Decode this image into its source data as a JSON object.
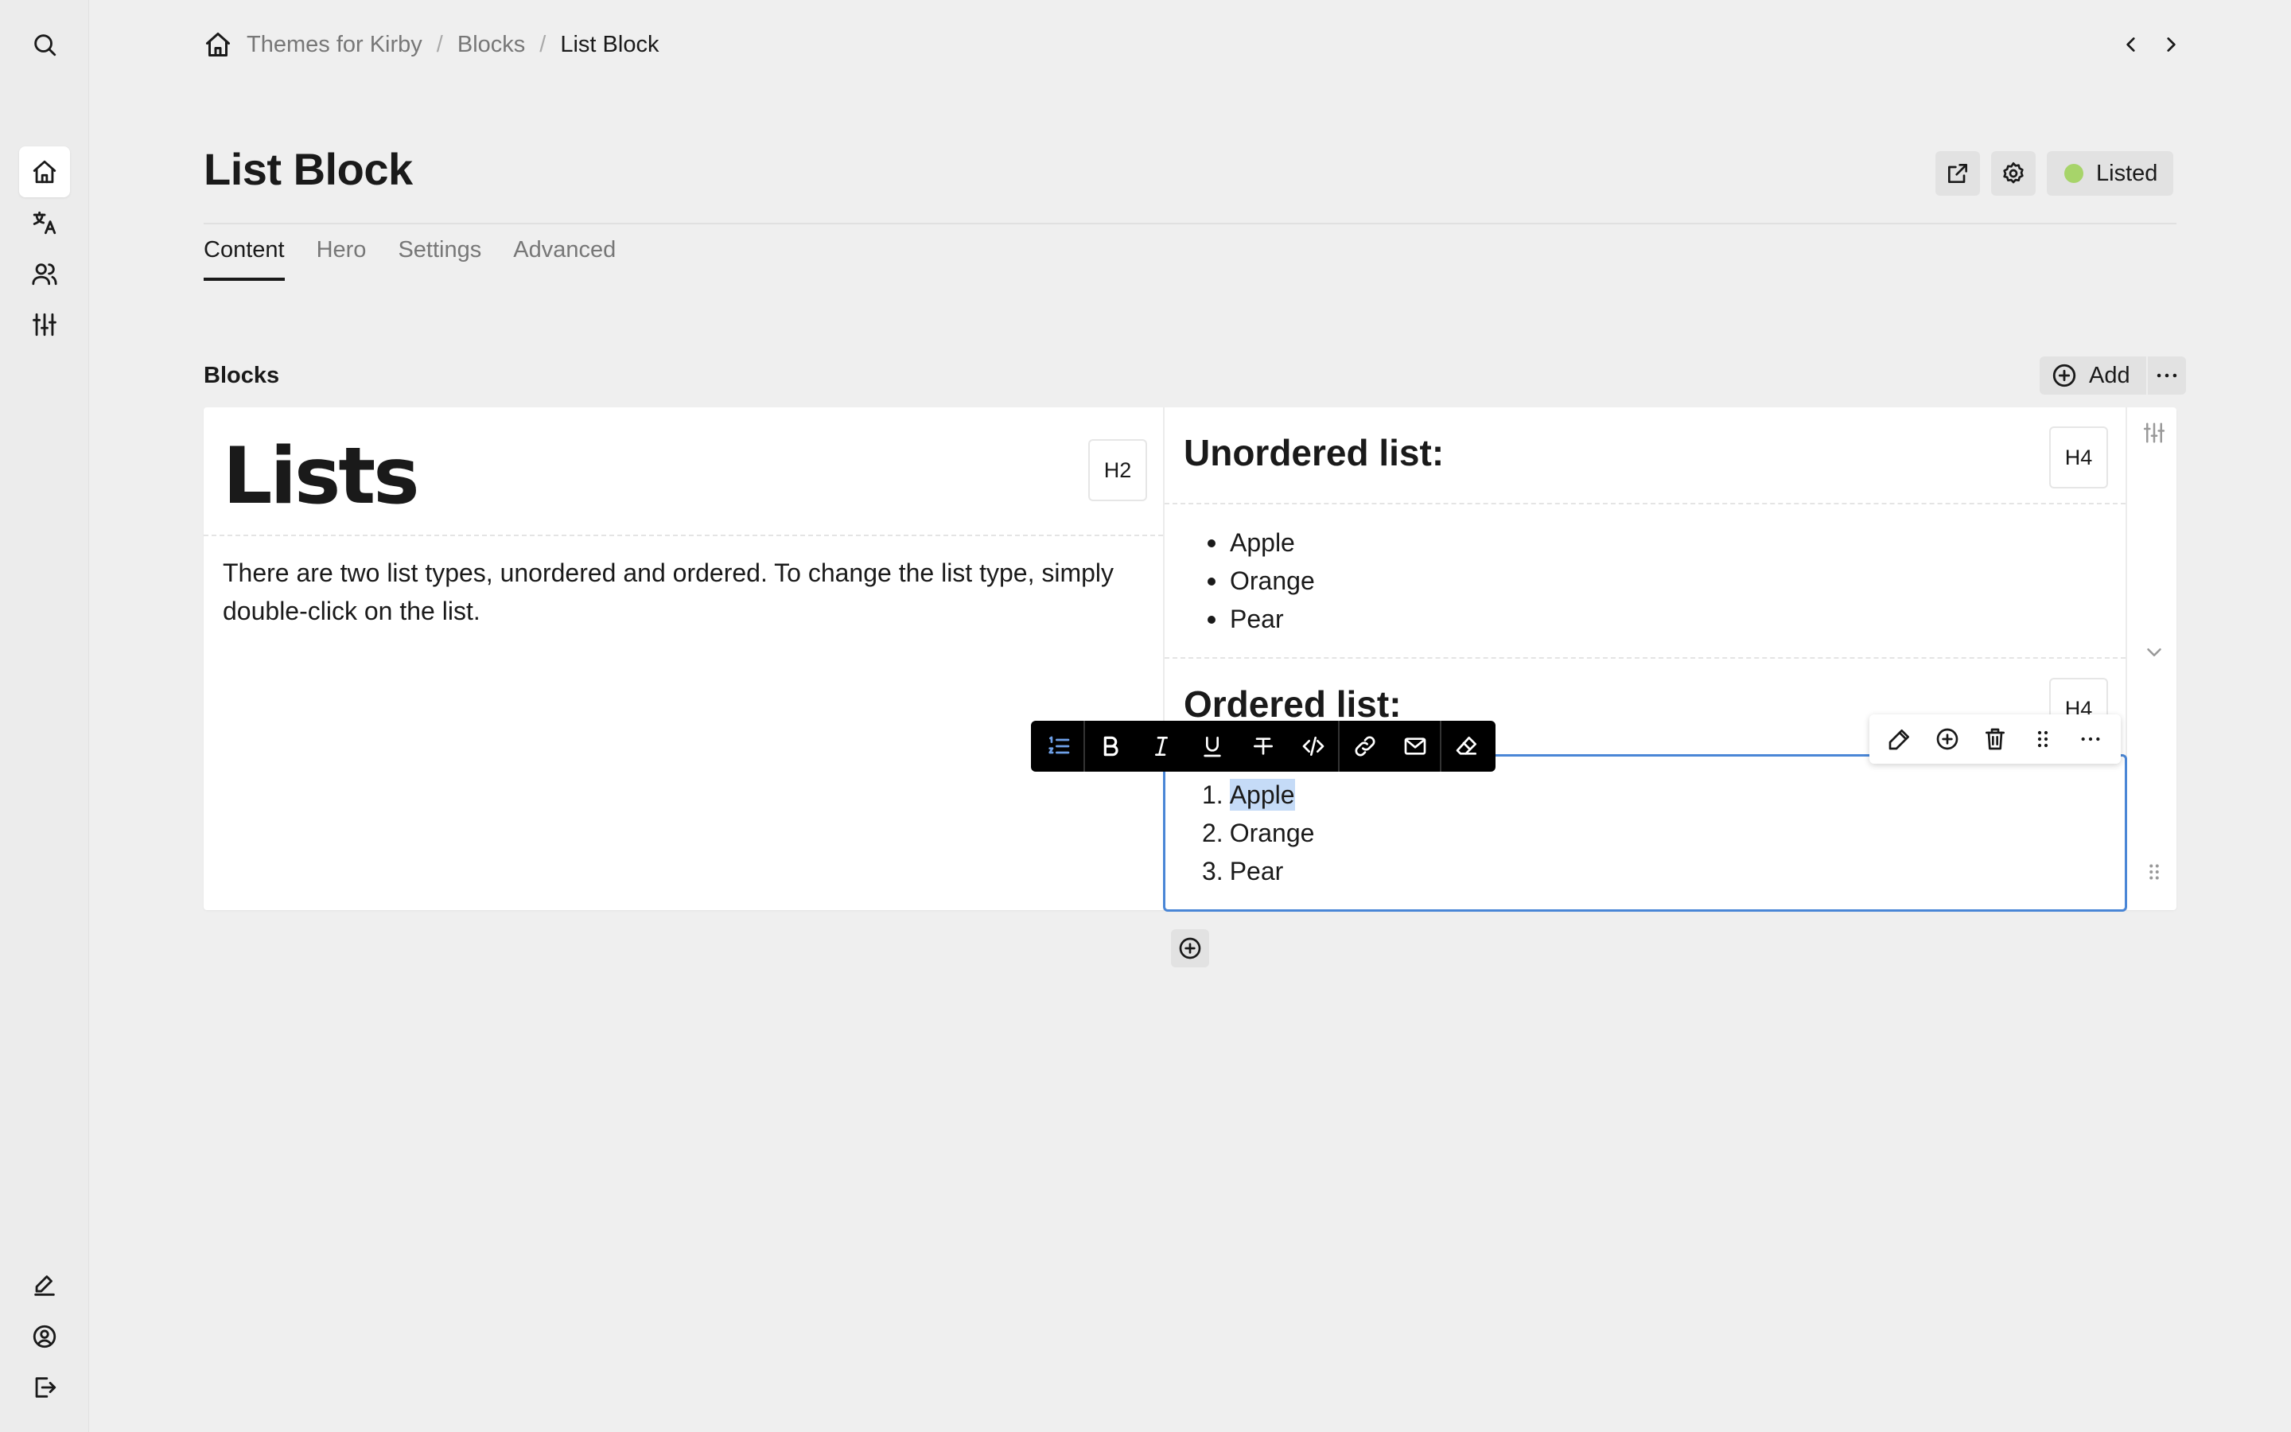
{
  "menu": {
    "search_icon": "search-icon",
    "items": [
      {
        "name": "site",
        "icon": "home-icon",
        "active": true
      },
      {
        "name": "languages",
        "icon": "translate-icon",
        "active": false
      },
      {
        "name": "users",
        "icon": "users-icon",
        "active": false
      },
      {
        "name": "system",
        "icon": "sliders-icon",
        "active": false
      }
    ],
    "bottom": [
      {
        "name": "edit",
        "icon": "pencil-icon"
      },
      {
        "name": "account",
        "icon": "user-circle-icon"
      },
      {
        "name": "logout",
        "icon": "logout-icon"
      }
    ]
  },
  "breadcrumb": {
    "items": [
      "Themes for Kirby",
      "Blocks",
      "List Block"
    ],
    "separator": "/"
  },
  "header": {
    "title": "List Block",
    "status_label": "Listed",
    "status_color": "#a7d46a"
  },
  "tabs": [
    "Content",
    "Hero",
    "Settings",
    "Advanced"
  ],
  "blocks": {
    "label": "Blocks",
    "add_label": "Add",
    "left": {
      "heading": "Lists",
      "heading_level": "H2",
      "paragraph": "There are two list types, unordered and ordered. To change the list type, simply double-click on the list."
    },
    "right": {
      "unordered_heading": "Unordered list:",
      "unordered_level": "H4",
      "unordered_items": [
        "Apple",
        "Orange",
        "Pear"
      ],
      "ordered_heading": "Ordered list:",
      "ordered_level": "H4",
      "ordered_items": [
        {
          "num": "1.",
          "text": "Apple"
        },
        {
          "num": "2.",
          "text": "Orange"
        },
        {
          "num": "3.",
          "text": "Pear"
        }
      ]
    }
  },
  "colors": {
    "focus": "#4a86d6",
    "selection": "#c5dbf7",
    "toolbar_active": "#6ea0e8"
  }
}
